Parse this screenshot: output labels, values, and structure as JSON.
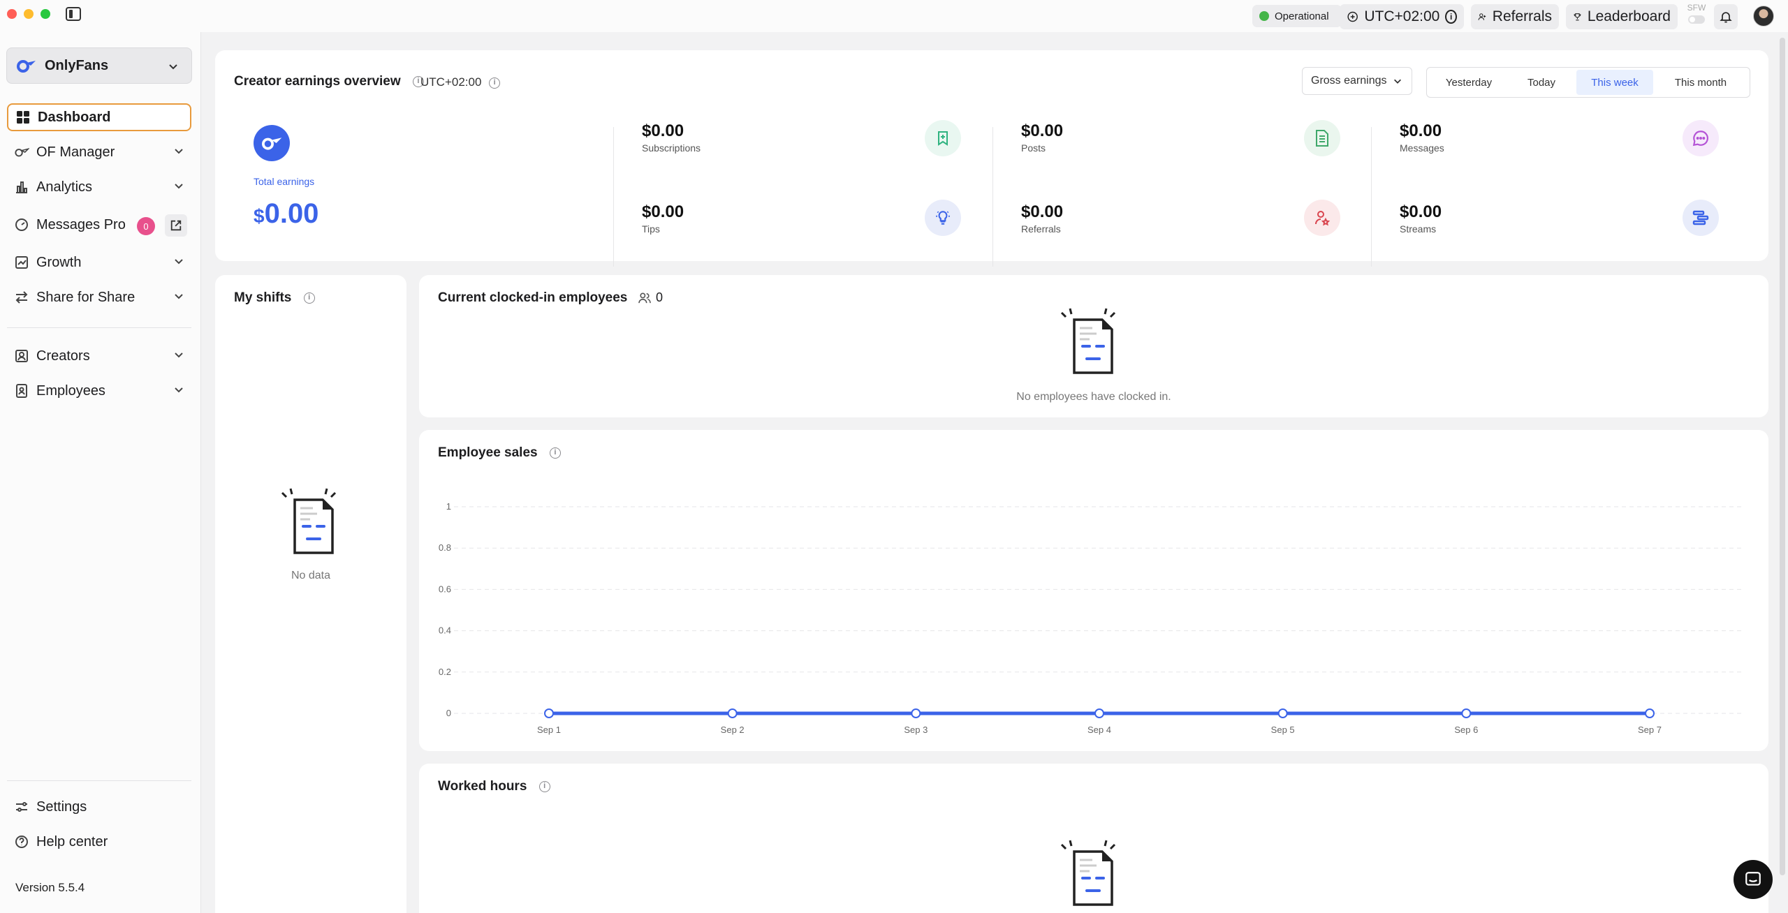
{
  "topbar": {
    "status": "Operational",
    "timezone": "UTC+02:00",
    "referrals": "Referrals",
    "leaderboard": "Leaderboard",
    "sfw": "SFW"
  },
  "sidebar": {
    "platform": "OnlyFans",
    "items": [
      {
        "label": "Dashboard"
      },
      {
        "label": "OF Manager"
      },
      {
        "label": "Analytics"
      },
      {
        "label": "Messages Pro",
        "badge": "0"
      },
      {
        "label": "Growth"
      },
      {
        "label": "Share for Share"
      },
      {
        "label": "Creators"
      },
      {
        "label": "Employees"
      }
    ],
    "settings": "Settings",
    "help": "Help center",
    "version": "Version 5.5.4"
  },
  "overview": {
    "title": "Creator earnings overview",
    "timezone": "UTC+02:00",
    "dropdown": "Gross earnings",
    "ranges": [
      "Yesterday",
      "Today",
      "This week",
      "This month"
    ],
    "selected_range": "This week",
    "total_label": "Total earnings",
    "total_currency": "$",
    "total_value": "0.00",
    "stats": [
      {
        "value": "$0.00",
        "label": "Subscriptions",
        "icon": "bookmark-plus-icon"
      },
      {
        "value": "$0.00",
        "label": "Tips",
        "icon": "lightbulb-icon"
      },
      {
        "value": "$0.00",
        "label": "Posts",
        "icon": "document-icon"
      },
      {
        "value": "$0.00",
        "label": "Referrals",
        "icon": "user-star-icon"
      },
      {
        "value": "$0.00",
        "label": "Messages",
        "icon": "chat-bubble-icon"
      },
      {
        "value": "$0.00",
        "label": "Streams",
        "icon": "streams-icon"
      }
    ]
  },
  "shifts": {
    "title": "My shifts",
    "empty": "No data"
  },
  "clocked": {
    "title": "Current clocked-in employees",
    "count": "0",
    "empty": "No employees have clocked in."
  },
  "sales": {
    "title": "Employee sales"
  },
  "worked": {
    "title": "Worked hours"
  },
  "colors": {
    "accent": "#3b63e8",
    "status_green": "#45b549",
    "badge_pink": "#e8508c"
  },
  "chart_data": {
    "type": "line",
    "categories": [
      "Sep 1",
      "Sep 2",
      "Sep 3",
      "Sep 4",
      "Sep 5",
      "Sep 6",
      "Sep 7"
    ],
    "series": [
      {
        "values": [
          0,
          0,
          0,
          0,
          0,
          0,
          0
        ]
      }
    ],
    "ylim": [
      0,
      1
    ],
    "yticks": [
      "0",
      "0.2",
      "0.4",
      "0.6",
      "0.8",
      "1"
    ],
    "grid": true
  }
}
